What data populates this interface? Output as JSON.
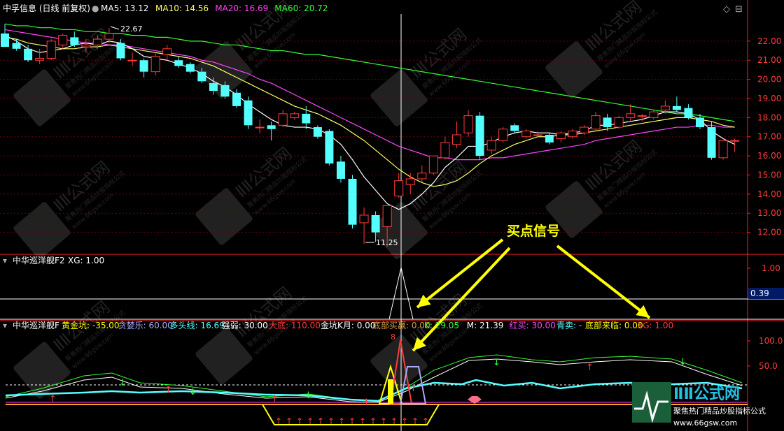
{
  "colors": {
    "bg": "#000000",
    "grid": "#6b0000",
    "axis": "#ff2020",
    "axisText": "#ff3b3b",
    "up": "#ff3b3b",
    "down": "#54ffff",
    "ma5": "#ffffff",
    "ma10": "#ffff66",
    "ma20": "#ff44ff",
    "ma60": "#33ff33",
    "yellow": "#ffff00",
    "annotation": "#ffff00"
  },
  "main": {
    "title": "中孚信息 (日线 前复权)",
    "ma": [
      {
        "label": "MA5: 13.12",
        "color": "#ffffff"
      },
      {
        "label": "MA10: 14.56",
        "color": "#ffff66"
      },
      {
        "label": "MA20: 16.69",
        "color": "#ff44ff"
      },
      {
        "label": "MA60: 20.72",
        "color": "#33ff33"
      }
    ],
    "high_label": "22.67",
    "low_label": "11.25",
    "y_ticks": [
      "22.00",
      "21.00",
      "20.00",
      "19.00",
      "18.00",
      "17.00",
      "16.00",
      "15.00",
      "14.00",
      "13.00",
      "12.00"
    ],
    "annotation": "买点信号"
  },
  "panel2": {
    "title": "中华巡洋舰F2",
    "xg": "XG: 1.00",
    "y_ticks": [
      "1.00",
      "0.39"
    ]
  },
  "panel3": {
    "title": "中华巡洋舰F",
    "items": [
      {
        "text": "黄金坑: -35.00",
        "color": "#ffff00"
      },
      {
        "text": "贪婪乐: 60.00",
        "color": "#aaaaff"
      },
      {
        "text": "多头线: 16.69",
        "color": "#54ffff"
      },
      {
        "text": "强弱: 30.00",
        "color": "#ffffff"
      },
      {
        "text": "大底: 110.00",
        "color": "#ff3b3b"
      },
      {
        "text": "金坑K月: 0.00",
        "color": "#ffffff"
      },
      {
        "text": "底部买赢: 0.00",
        "color": "#d8a040"
      },
      {
        "text": "K: 29.05",
        "color": "#33ff33"
      },
      {
        "text": "M: 21.39",
        "color": "#ffffff"
      },
      {
        "text": "红买: 30.00",
        "color": "#ff44ff"
      },
      {
        "text": "青卖: -",
        "color": "#54ffff"
      },
      {
        "text": "底部来临: 0.00",
        "color": "#ffff00"
      },
      {
        "text": "XG: 1.00",
        "color": "#ff3b3b"
      }
    ],
    "y_ticks": [
      "100.0",
      "50.0"
    ],
    "top_marker": "8"
  },
  "watermark": {
    "site": "www.66gsw.com",
    "slogan": "聚焦热门精品炒股指标公式"
  },
  "chart_data": {
    "type": "candlestick",
    "ylim": [
      11.0,
      23.2
    ],
    "candles": [
      {
        "o": 22.4,
        "h": 22.9,
        "l": 21.7,
        "c": 21.7
      },
      {
        "o": 21.9,
        "h": 22.1,
        "l": 21.5,
        "c": 21.6
      },
      {
        "o": 21.6,
        "h": 21.8,
        "l": 20.9,
        "c": 21.0
      },
      {
        "o": 21.0,
        "h": 21.6,
        "l": 20.8,
        "c": 21.1
      },
      {
        "o": 21.1,
        "h": 22.1,
        "l": 21.0,
        "c": 22.0
      },
      {
        "o": 21.8,
        "h": 22.4,
        "l": 21.6,
        "c": 22.3
      },
      {
        "o": 22.2,
        "h": 22.5,
        "l": 21.7,
        "c": 21.8
      },
      {
        "o": 21.7,
        "h": 22.1,
        "l": 21.4,
        "c": 21.8
      },
      {
        "o": 21.8,
        "h": 22.3,
        "l": 21.6,
        "c": 22.1
      },
      {
        "o": 22.1,
        "h": 22.67,
        "l": 21.9,
        "c": 22.4
      },
      {
        "o": 21.9,
        "h": 22.1,
        "l": 21.0,
        "c": 21.1
      },
      {
        "o": 21.0,
        "h": 21.4,
        "l": 20.7,
        "c": 21.0
      },
      {
        "o": 21.0,
        "h": 21.1,
        "l": 20.1,
        "c": 20.4
      },
      {
        "o": 20.4,
        "h": 21.4,
        "l": 20.2,
        "c": 21.2
      },
      {
        "o": 21.3,
        "h": 21.8,
        "l": 21.0,
        "c": 21.6
      },
      {
        "o": 21.0,
        "h": 21.2,
        "l": 20.6,
        "c": 20.7
      },
      {
        "o": 20.8,
        "h": 20.9,
        "l": 20.3,
        "c": 20.4
      },
      {
        "o": 20.4,
        "h": 20.6,
        "l": 19.8,
        "c": 19.9
      },
      {
        "o": 19.8,
        "h": 20.1,
        "l": 19.2,
        "c": 19.4
      },
      {
        "o": 19.7,
        "h": 19.9,
        "l": 19.0,
        "c": 19.1
      },
      {
        "o": 19.3,
        "h": 19.5,
        "l": 18.5,
        "c": 18.6
      },
      {
        "o": 18.9,
        "h": 19.1,
        "l": 17.4,
        "c": 17.6
      },
      {
        "o": 17.5,
        "h": 17.9,
        "l": 17.2,
        "c": 17.5
      },
      {
        "o": 17.6,
        "h": 17.8,
        "l": 16.8,
        "c": 17.4
      },
      {
        "o": 17.6,
        "h": 18.4,
        "l": 17.5,
        "c": 18.2
      },
      {
        "o": 18.0,
        "h": 18.3,
        "l": 17.9,
        "c": 18.2
      },
      {
        "o": 18.2,
        "h": 18.6,
        "l": 17.4,
        "c": 17.7
      },
      {
        "o": 17.5,
        "h": 17.6,
        "l": 16.9,
        "c": 17.0
      },
      {
        "o": 17.3,
        "h": 17.4,
        "l": 15.5,
        "c": 15.6
      },
      {
        "o": 15.7,
        "h": 16.0,
        "l": 14.6,
        "c": 14.8
      },
      {
        "o": 14.8,
        "h": 15.0,
        "l": 12.2,
        "c": 12.4
      },
      {
        "o": 12.5,
        "h": 13.3,
        "l": 11.4,
        "c": 12.9
      },
      {
        "o": 12.9,
        "h": 13.1,
        "l": 11.5,
        "c": 12.0
      },
      {
        "o": 12.3,
        "h": 13.4,
        "l": 11.25,
        "c": 13.4
      },
      {
        "o": 13.9,
        "h": 15.1,
        "l": 13.8,
        "c": 14.7
      },
      {
        "o": 14.5,
        "h": 15.1,
        "l": 14.0,
        "c": 14.8
      },
      {
        "o": 14.8,
        "h": 15.5,
        "l": 14.6,
        "c": 15.1
      },
      {
        "o": 15.1,
        "h": 16.0,
        "l": 15.0,
        "c": 16.0
      },
      {
        "o": 15.9,
        "h": 17.0,
        "l": 15.8,
        "c": 16.7
      },
      {
        "o": 16.6,
        "h": 17.8,
        "l": 16.4,
        "c": 17.1
      },
      {
        "o": 17.2,
        "h": 18.4,
        "l": 17.0,
        "c": 18.1
      },
      {
        "o": 18.1,
        "h": 18.3,
        "l": 15.8,
        "c": 16.0
      },
      {
        "o": 16.3,
        "h": 17.0,
        "l": 16.1,
        "c": 16.8
      },
      {
        "o": 16.8,
        "h": 17.5,
        "l": 16.7,
        "c": 17.4
      },
      {
        "o": 17.6,
        "h": 17.7,
        "l": 17.2,
        "c": 17.3
      },
      {
        "o": 17.0,
        "h": 17.4,
        "l": 16.9,
        "c": 17.3
      },
      {
        "o": 17.1,
        "h": 17.3,
        "l": 17.0,
        "c": 17.1
      },
      {
        "o": 17.1,
        "h": 17.2,
        "l": 16.6,
        "c": 16.7
      },
      {
        "o": 16.9,
        "h": 17.3,
        "l": 16.7,
        "c": 17.2
      },
      {
        "o": 17.0,
        "h": 17.4,
        "l": 16.9,
        "c": 17.3
      },
      {
        "o": 17.2,
        "h": 17.6,
        "l": 17.1,
        "c": 17.5
      },
      {
        "o": 17.4,
        "h": 18.3,
        "l": 17.3,
        "c": 18.1
      },
      {
        "o": 18.0,
        "h": 18.2,
        "l": 17.3,
        "c": 17.5
      },
      {
        "o": 17.5,
        "h": 18.1,
        "l": 17.4,
        "c": 18.0
      },
      {
        "o": 18.0,
        "h": 18.7,
        "l": 17.8,
        "c": 18.2
      },
      {
        "o": 18.1,
        "h": 18.2,
        "l": 17.8,
        "c": 18.1
      },
      {
        "o": 18.0,
        "h": 18.4,
        "l": 17.9,
        "c": 18.3
      },
      {
        "o": 18.4,
        "h": 18.9,
        "l": 18.2,
        "c": 18.6
      },
      {
        "o": 18.6,
        "h": 19.1,
        "l": 18.3,
        "c": 18.4
      },
      {
        "o": 18.5,
        "h": 18.7,
        "l": 17.9,
        "c": 18.0
      },
      {
        "o": 18.0,
        "h": 18.2,
        "l": 17.4,
        "c": 17.5
      },
      {
        "o": 17.5,
        "h": 17.8,
        "l": 15.8,
        "c": 15.9
      },
      {
        "o": 15.9,
        "h": 16.8,
        "l": 15.8,
        "c": 16.8
      },
      {
        "o": 16.8,
        "h": 16.9,
        "l": 16.2,
        "c": 16.8
      }
    ],
    "ma5": [
      22.3,
      22.0,
      21.6,
      21.4,
      21.5,
      21.6,
      21.8,
      21.9,
      21.8,
      22.0,
      21.9,
      21.6,
      21.2,
      21.1,
      21.0,
      20.8,
      20.6,
      20.3,
      19.9,
      19.6,
      19.2,
      18.7,
      18.3,
      17.9,
      17.6,
      17.5,
      17.5,
      17.4,
      17.1,
      16.6,
      15.8,
      14.9,
      14.2,
      13.5,
      13.2,
      13.5,
      14.0,
      14.6,
      15.4,
      15.9,
      16.5,
      16.5,
      16.7,
      17.0,
      17.2,
      17.3,
      17.2,
      17.2,
      17.1,
      17.2,
      17.3,
      17.6,
      17.6,
      17.7,
      17.8,
      17.9,
      18.1,
      18.3,
      18.3,
      18.2,
      17.9,
      17.3,
      16.9,
      16.6
    ],
    "ma10": [
      22.2,
      22.1,
      21.9,
      21.8,
      21.7,
      21.6,
      21.6,
      21.7,
      21.7,
      21.8,
      21.7,
      21.6,
      21.5,
      21.4,
      21.3,
      21.2,
      21.1,
      20.9,
      20.7,
      20.4,
      20.1,
      19.8,
      19.5,
      19.2,
      18.9,
      18.6,
      18.4,
      18.2,
      17.9,
      17.6,
      17.2,
      16.8,
      16.3,
      15.8,
      15.3,
      14.9,
      14.6,
      14.4,
      14.5,
      14.7,
      15.1,
      15.6,
      16.0,
      16.3,
      16.6,
      16.8,
      17.0,
      17.0,
      17.1,
      17.1,
      17.2,
      17.3,
      17.4,
      17.5,
      17.6,
      17.7,
      17.8,
      17.9,
      18.0,
      18.0,
      17.9,
      17.8,
      17.6,
      17.5
    ],
    "ma20": [
      22.6,
      22.5,
      22.4,
      22.3,
      22.2,
      22.1,
      22.0,
      21.9,
      21.9,
      21.8,
      21.8,
      21.7,
      21.6,
      21.5,
      21.4,
      21.3,
      21.2,
      21.0,
      20.9,
      20.7,
      20.5,
      20.3,
      20.0,
      19.8,
      19.5,
      19.2,
      18.9,
      18.6,
      18.3,
      18.0,
      17.7,
      17.4,
      17.1,
      16.8,
      16.5,
      16.3,
      16.1,
      15.9,
      15.9,
      15.8,
      15.8,
      15.8,
      15.9,
      15.9,
      16.0,
      16.1,
      16.2,
      16.3,
      16.4,
      16.5,
      16.6,
      16.8,
      16.9,
      17.0,
      17.1,
      17.2,
      17.3,
      17.4,
      17.5,
      17.5,
      17.6,
      17.6,
      17.5,
      17.5
    ],
    "ma60": [
      22.9,
      22.8,
      22.8,
      22.7,
      22.7,
      22.6,
      22.6,
      22.5,
      22.5,
      22.4,
      22.4,
      22.3,
      22.3,
      22.2,
      22.2,
      22.1,
      22.0,
      22.0,
      21.9,
      21.8,
      21.8,
      21.7,
      21.6,
      21.5,
      21.5,
      21.4,
      21.3,
      21.3,
      21.2,
      21.1,
      21.0,
      20.9,
      20.8,
      20.7,
      20.6,
      20.5,
      20.4,
      20.3,
      20.2,
      20.1,
      20.0,
      19.9,
      19.8,
      19.7,
      19.6,
      19.5,
      19.4,
      19.3,
      19.2,
      19.1,
      19.0,
      18.9,
      18.8,
      18.7,
      18.6,
      18.5,
      18.4,
      18.3,
      18.2,
      18.2,
      18.1,
      18.0,
      17.9,
      17.8
    ]
  }
}
